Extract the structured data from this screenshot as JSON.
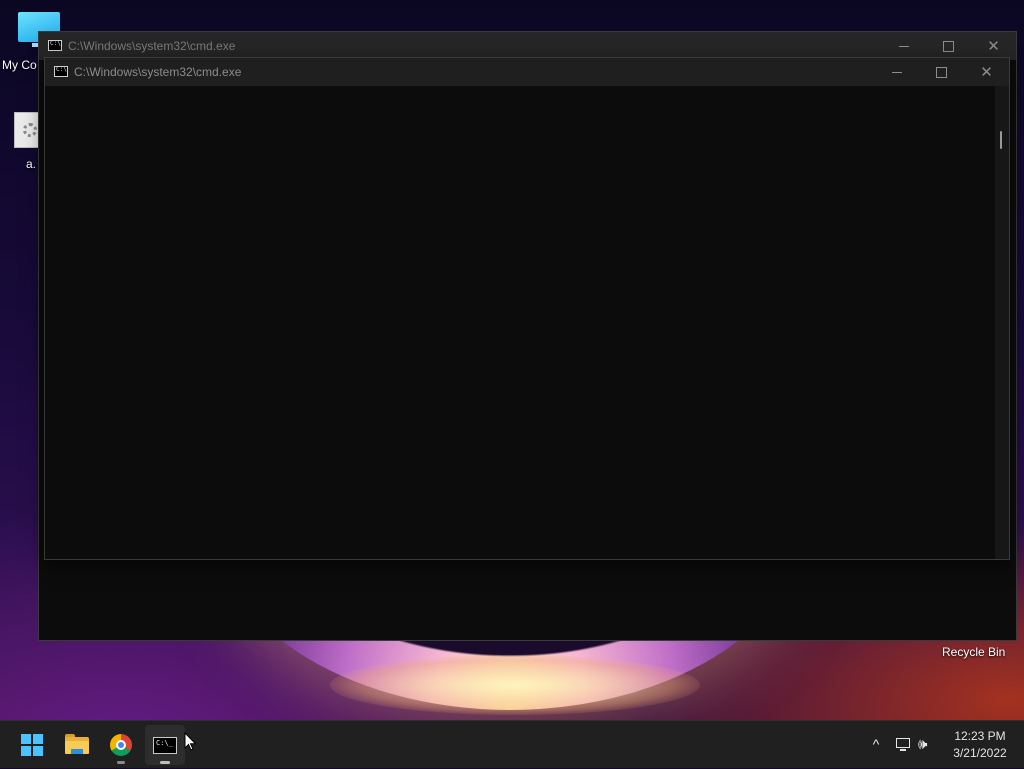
{
  "desktop": {
    "icons": {
      "computer_label": "My Co",
      "file_label": "a.",
      "recycle_bin_label": "Recycle Bin"
    }
  },
  "windows": {
    "back": {
      "title": "C:\\Windows\\system32\\cmd.exe",
      "minimize_icon": "minimize-icon",
      "maximize_icon": "maximize-icon",
      "close_icon": "close-icon",
      "close_glyph": "✕"
    },
    "front": {
      "title": "C:\\Windows\\system32\\cmd.exe",
      "minimize_icon": "minimize-icon",
      "maximize_icon": "maximize-icon",
      "close_icon": "close-icon",
      "close_glyph": "✕"
    }
  },
  "taskbar": {
    "apps": [
      {
        "name": "start",
        "icon": "windows-logo-icon"
      },
      {
        "name": "file-explorer",
        "icon": "folder-icon"
      },
      {
        "name": "chrome",
        "icon": "chrome-icon"
      },
      {
        "name": "command-prompt",
        "icon": "cmd-icon",
        "active": true
      }
    ],
    "tray": {
      "chevron": "^",
      "volume_glyph": "🕪",
      "time": "12:23 PM",
      "date": "3/21/2022"
    }
  },
  "colors": {
    "accent": "#4cc2ff",
    "console_bg": "#0c0c0c",
    "titlebar_bg": "#1f1f1f",
    "taskbar_bg": "#202020"
  }
}
